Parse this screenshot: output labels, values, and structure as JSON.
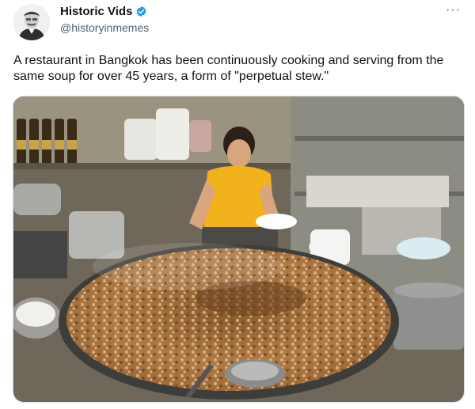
{
  "tweet": {
    "display_name": "Historic Vids",
    "handle": "@historyinmemes",
    "verified": true,
    "more_icon": "more-options-icon",
    "text": "A restaurant in Bangkok has been continuously cooking and serving from the same soup for over 45 years, a form of \"perpetual stew.\""
  },
  "colors": {
    "verified_badge": "#1d9bf0",
    "text_primary": "#0f1419",
    "text_secondary": "#536471"
  }
}
